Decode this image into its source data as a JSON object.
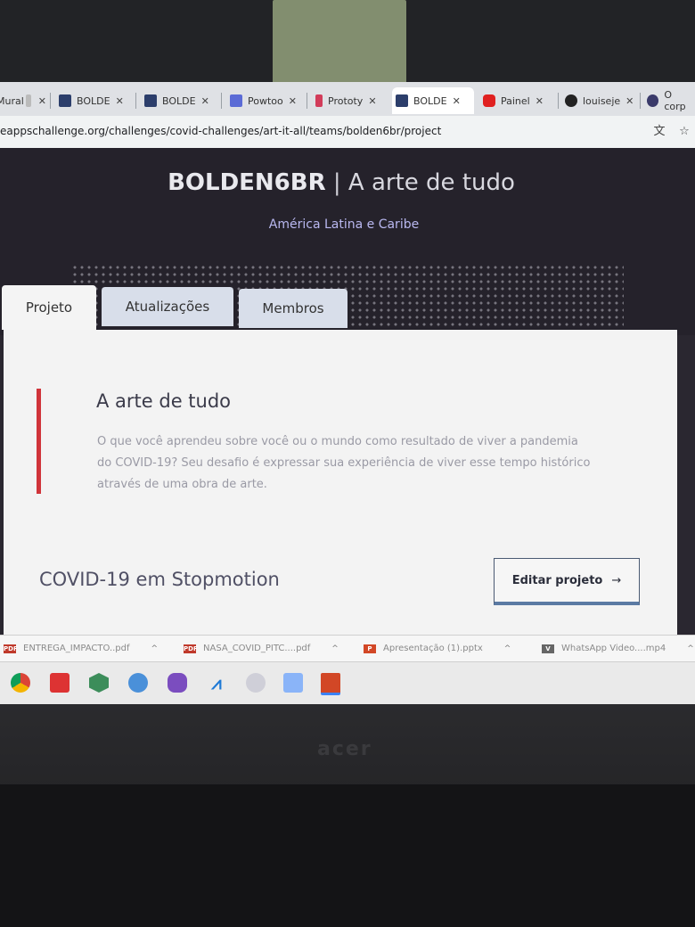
{
  "browser": {
    "tabs": [
      {
        "label": "Mural",
        "color": "#e8a23a"
      },
      {
        "label": "BOLDE",
        "color": "#2c3e6b"
      },
      {
        "label": "BOLDE",
        "color": "#2c3e6b"
      },
      {
        "label": "Powtoo",
        "color": "#5b6bd6"
      },
      {
        "label": "Prototy",
        "color": "#d23c5a"
      },
      {
        "label": "BOLDE",
        "color": "#2c3e6b"
      },
      {
        "label": "Painel",
        "color": "#e02020"
      },
      {
        "label": "louiseje",
        "color": "#222222"
      },
      {
        "label": "O corp",
        "color": "#3a3a6a"
      }
    ],
    "url": "eappschallenge.org/challenges/covid-challenges/art-it-all/teams/bolden6br/project"
  },
  "hero": {
    "team": "BOLDEN6BR",
    "separator": "|",
    "challenge": "A arte de tudo",
    "region": "América Latina e Caribe"
  },
  "page_tabs": {
    "project": "Projeto",
    "updates": "Atualizações",
    "members": "Membros"
  },
  "challenge": {
    "title": "A arte de tudo",
    "description": "O que você aprendeu sobre você ou o mundo como resultado de viver a pandemia do COVID-19? Seu desafio é expressar sua experiência de viver esse tempo histórico através de uma obra de arte."
  },
  "project": {
    "name": "COVID-19 em Stopmotion",
    "edit_label": "Editar projeto",
    "edit_arrow": "→"
  },
  "downloads": [
    {
      "name": "ENTREGA_IMPACTO..pdf",
      "type": "PDF"
    },
    {
      "name": "NASA_COVID_PITC....pdf",
      "type": "PDF"
    },
    {
      "name": "Apresentação (1).pptx",
      "type": "P"
    },
    {
      "name": "WhatsApp Video....mp4",
      "type": "V"
    }
  ],
  "monitor_brand": "acer",
  "colors": {
    "accent_red": "#d0343a",
    "hero_bg": "#25222b",
    "region_text": "#b9b8f0"
  }
}
